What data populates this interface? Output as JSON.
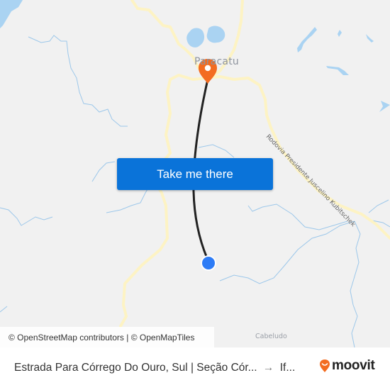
{
  "map": {
    "attribution": "© OpenStreetMap contributors | © OpenMapTiles",
    "places": {
      "city": "Paracatu",
      "locality": "Cabeludo"
    },
    "road_label": "Rodovia Presidente Juscelino Kubitschek",
    "colors": {
      "background": "#f1f1f1",
      "water": "#aad3f2",
      "river": "#9cc7ea",
      "road": "#fdf3c4",
      "route_line": "#222222",
      "destination_pin": "#f36c21",
      "origin_dot": "#2e7cf6"
    },
    "markers": {
      "origin": "origin-dot",
      "destination": "destination-pin"
    }
  },
  "cta": {
    "label": "Take me there",
    "color": "#0a73d9"
  },
  "footer": {
    "origin": "Estrada Para Córrego Do Ouro, Sul | Seção Cór...",
    "arrow": "→",
    "destination": "If...",
    "brand": "moovit",
    "brand_color": "#f36c21"
  }
}
